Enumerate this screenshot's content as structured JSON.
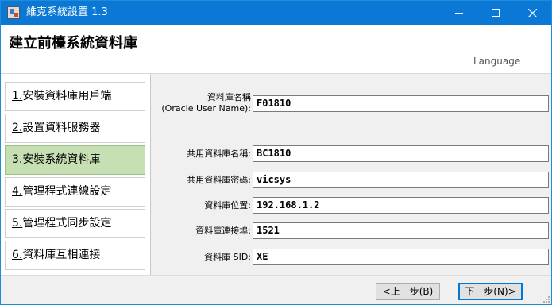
{
  "window": {
    "title": "維克系統設置 1.3",
    "minimize_label": "minimize",
    "maximize_label": "maximize",
    "close_label": "close"
  },
  "header": {
    "title": "建立前檯系統資料庫",
    "language_label": "Language"
  },
  "sidebar": {
    "items": [
      {
        "num": "1.",
        "label": "安裝資料庫用戶端",
        "active": false
      },
      {
        "num": "2.",
        "label": "設置資料服務器",
        "active": false
      },
      {
        "num": "3.",
        "label": "安裝系統資料庫",
        "active": true
      },
      {
        "num": "4.",
        "label": "管理程式連線設定",
        "active": false
      },
      {
        "num": "5.",
        "label": "管理程式同步設定",
        "active": false
      },
      {
        "num": "6.",
        "label": "資料庫互相連接",
        "active": false
      }
    ]
  },
  "form": {
    "db_name_label_line1": "資料庫名稱",
    "db_name_label_line2": "(Oracle User Name):",
    "db_name_value": "F01810",
    "shared_db_name_label": "共用資料庫名稱:",
    "shared_db_name_value": "BC1810",
    "shared_db_password_label": "共用資料庫密碼:",
    "shared_db_password_value": "vicsys",
    "db_location_label": "資料庫位置:",
    "db_location_value": "192.168.1.2",
    "db_port_label": "資料庫連接埠:",
    "db_port_value": "1521",
    "db_sid_label": "資料庫 SID:",
    "db_sid_value": "XE"
  },
  "footer": {
    "prev_label": "<上一步(B)",
    "next_label": "下一步(N)>"
  },
  "colors": {
    "titlebar": "#0a78d4",
    "active_step": "#c6e0b4",
    "default_button_border": "#0078d7"
  }
}
